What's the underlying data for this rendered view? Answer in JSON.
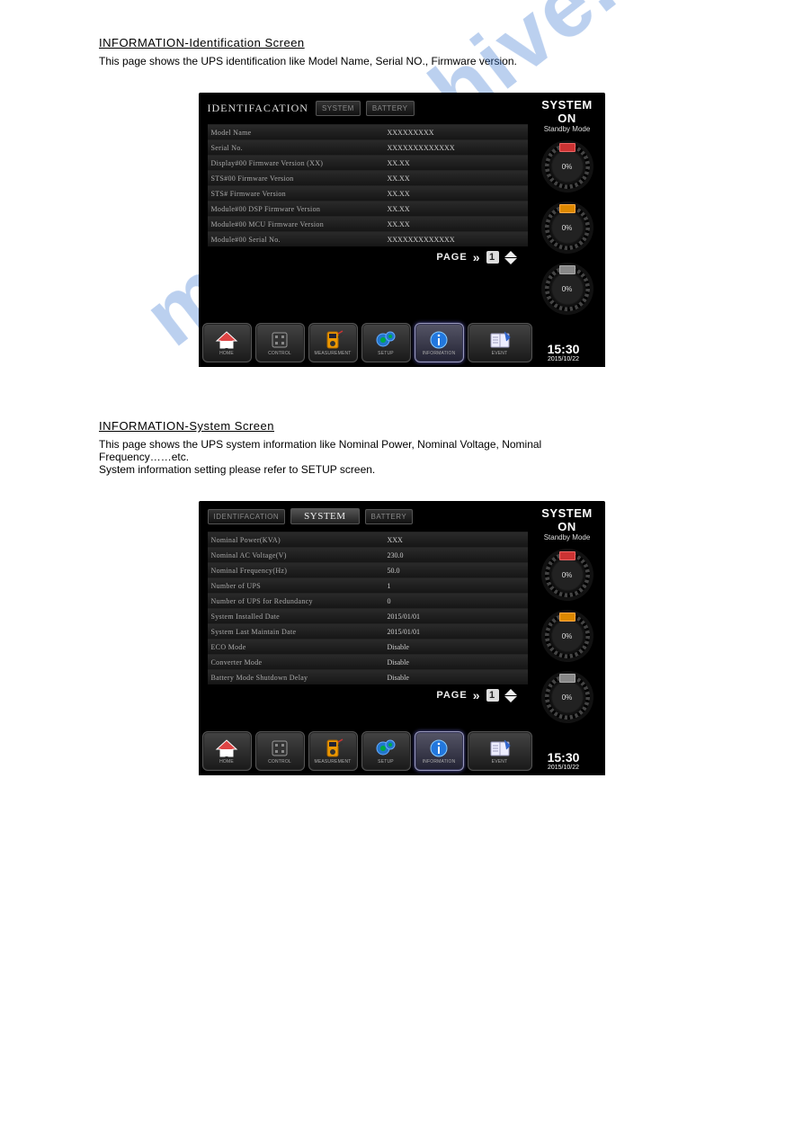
{
  "watermark": "manualshive.com",
  "section1": {
    "title": "INFORMATION-Identification Screen",
    "desc": "This page shows the UPS identification like Model Name, Serial NO., Firmware version."
  },
  "section2": {
    "title": "INFORMATION-System Screen",
    "desc_lines": [
      "This page shows the UPS system information like Nominal Power, Nominal Voltage, Nominal",
      "Frequency……etc.",
      "System information setting please refer to SETUP screen."
    ]
  },
  "common": {
    "system_on": "SYSTEM ON",
    "mode": "Standby Mode",
    "gauge_pct": "0%",
    "page_label": "PAGE",
    "page_num": "1",
    "tabs": {
      "id": "IDENTIFACATION",
      "sys": "SYSTEM",
      "bat": "BATTERY"
    },
    "nav": {
      "home": "HOME",
      "control": "CONTROL",
      "measure": "MEASUREMENT",
      "setup": "SETUP",
      "info": "INFORMATION",
      "event": "EVENT"
    },
    "clock": {
      "time": "15:30",
      "date": "2015/10/22"
    }
  },
  "screen1": {
    "rows": [
      {
        "label": "Model Name",
        "value": "XXXXXXXXX"
      },
      {
        "label": "Serial No.",
        "value": "XXXXXXXXXXXXX"
      },
      {
        "label": "Display#00 Firmware Version      (XX)",
        "value": "XX.XX"
      },
      {
        "label": "STS#00 Firmware Version",
        "value": "XX.XX"
      },
      {
        "label": "STS#   Firmware Version",
        "value": "XX.XX"
      },
      {
        "label": "Module#00 DSP Firmware Version",
        "value": "XX.XX"
      },
      {
        "label": "Module#00 MCU Firmware Version",
        "value": "XX.XX"
      },
      {
        "label": "Module#00 Serial No.",
        "value": "XXXXXXXXXXXXX"
      }
    ]
  },
  "screen2": {
    "rows": [
      {
        "label": "Nominal Power(KVA)",
        "value": "XXX"
      },
      {
        "label": "Nominal AC Voltage(V)",
        "value": "230.0"
      },
      {
        "label": "Nominal Frequency(Hz)",
        "value": "50.0"
      },
      {
        "label": "Number of UPS",
        "value": "1"
      },
      {
        "label": "Number of UPS for Redundancy",
        "value": "0"
      },
      {
        "label": "System Installed Date",
        "value": "2015/01/01"
      },
      {
        "label": "System Last Maintain Date",
        "value": "2015/01/01"
      },
      {
        "label": "ECO Mode",
        "value": "Disable"
      },
      {
        "label": "Converter Mode",
        "value": "Disable"
      },
      {
        "label": "Battery Mode Shutdown Delay",
        "value": "Disable"
      }
    ]
  }
}
